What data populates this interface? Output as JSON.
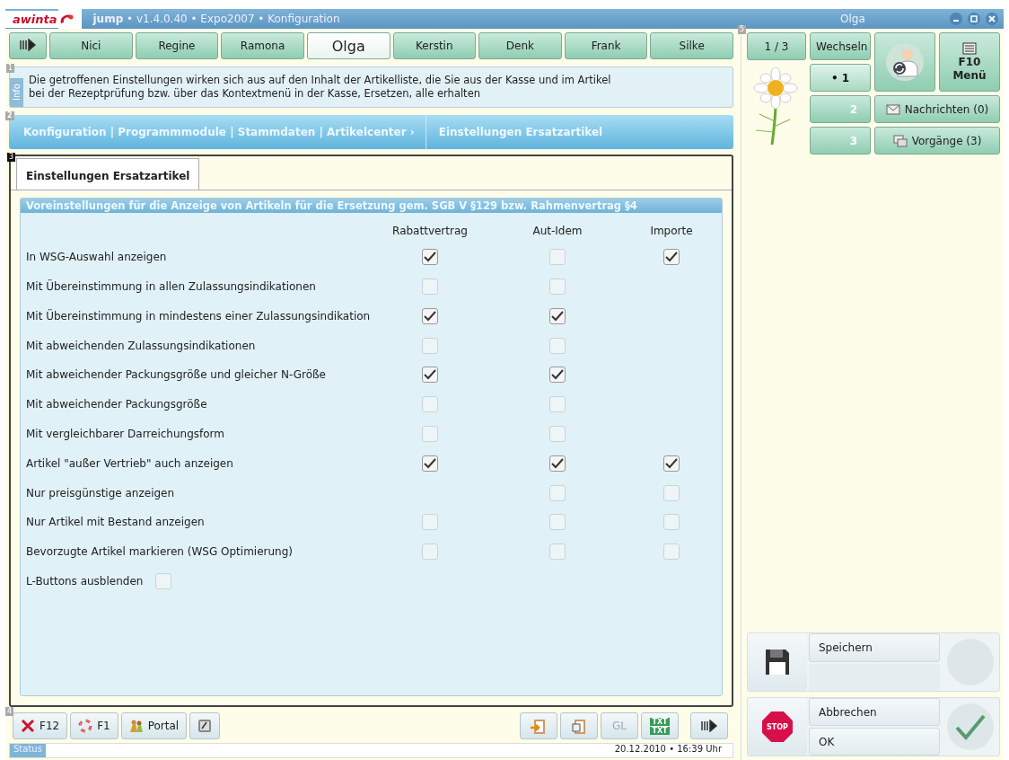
{
  "window": {
    "logo": "awinta",
    "app": "jump",
    "title": " • v1.4.0.40 • Expo2007 • Konfiguration",
    "user": "Olga"
  },
  "users": [
    {
      "label": "Nici",
      "selected": false
    },
    {
      "label": "Regine",
      "selected": false
    },
    {
      "label": "Ramona",
      "selected": false
    },
    {
      "label": "Olga",
      "selected": true
    },
    {
      "label": "Kerstin",
      "selected": false
    },
    {
      "label": "Denk",
      "selected": false
    },
    {
      "label": "Frank",
      "selected": false
    },
    {
      "label": "Silke",
      "selected": false
    }
  ],
  "markers": [
    "1",
    "2",
    "3",
    "4",
    "5"
  ],
  "info": {
    "label": "Info",
    "text": "Die getroffenen Einstellungen wirken sich aus auf den Inhalt der Artikelliste, die Sie aus der Kasse und im Artikel\nbei der Rezeptprüfung bzw. über das Kontextmenü in der Kasse, Ersetzen, alle erhalten"
  },
  "breadcrumb": {
    "path": "Konfiguration | Programmmodule | Stammdaten | Artikelcenter ›",
    "current": "Einstellungen Ersatzartikel"
  },
  "tab": {
    "label": "Einstellungen Ersatzartikel",
    "selected": true
  },
  "settings": {
    "title": "Voreinstellungen für die Anzeige von Artikeln für die Ersetzung gem. SGB V §129 bzw. Rahmenvertrag §4",
    "columns": [
      "Rabattvertrag",
      "Aut-Idem",
      "Importe"
    ],
    "rows": [
      {
        "label": "In WSG-Auswahl anzeigen",
        "rabatt": true,
        "aut_idem": false,
        "importe": true
      },
      {
        "label": "Mit Übereinstimmung in allen Zulassungsindikationen",
        "rabatt": false,
        "aut_idem": false
      },
      {
        "label": "Mit Übereinstimmung in mindestens einer Zulassungsindikation",
        "rabatt": true,
        "aut_idem": true
      },
      {
        "label": "Mit abweichenden Zulassungsindikationen",
        "rabatt": false,
        "aut_idem": false
      },
      {
        "label": "Mit abweichender Packungsgröße und gleicher N-Größe",
        "rabatt": true,
        "aut_idem": true
      },
      {
        "label": "Mit abweichender Packungsgröße",
        "rabatt": false,
        "aut_idem": false
      },
      {
        "label": "Mit vergleichbarer Darreichungsform",
        "rabatt": false,
        "aut_idem": false
      },
      {
        "label": "Artikel \"außer Vertrieb\" auch anzeigen",
        "rabatt": true,
        "aut_idem": true,
        "importe": true
      },
      {
        "label": "Nur preisgünstige anzeigen",
        "aut_idem": false,
        "importe": false
      },
      {
        "label": "Nur Artikel mit Bestand anzeigen",
        "rabatt": false,
        "aut_idem": false,
        "importe": false
      },
      {
        "label": "Bevorzugte Artikel markieren (WSG Optimierung)",
        "rabatt": false,
        "aut_idem": false,
        "importe": false
      }
    ],
    "extra": {
      "label": "L-Buttons ausblenden",
      "checked": false
    }
  },
  "toolbar_left": [
    {
      "kind": "close",
      "label": "F12"
    },
    {
      "kind": "help",
      "label": "F1"
    },
    {
      "kind": "portal",
      "label": "Portal"
    },
    {
      "kind": "keyboard"
    }
  ],
  "toolbar_right": [
    {
      "kind": "paste",
      "disabled": false
    },
    {
      "kind": "copy",
      "disabled": false
    },
    {
      "kind": "text",
      "label": "GL",
      "disabled": true
    },
    {
      "kind": "txt",
      "labels": [
        "TXT",
        "TXT"
      ],
      "disabled": false
    },
    {
      "kind": "forward",
      "disabled": false
    }
  ],
  "status": {
    "label": "Status",
    "datetime": "20.12.2010 • 16:39 Uhr"
  },
  "side": {
    "page": "1 / 3",
    "switch": "Wechseln",
    "menu_key": "F10",
    "menu": "Menü",
    "slots": [
      {
        "label": "• 1",
        "selected": true
      },
      {
        "label": "2",
        "selected": false
      },
      {
        "label": "3",
        "selected": false
      }
    ],
    "messages": "Nachrichten (0)",
    "tasks": "Vorgänge (3)",
    "save": "Speichern",
    "cancel": "Abbrechen",
    "ok": "OK",
    "stop": "STOP"
  }
}
